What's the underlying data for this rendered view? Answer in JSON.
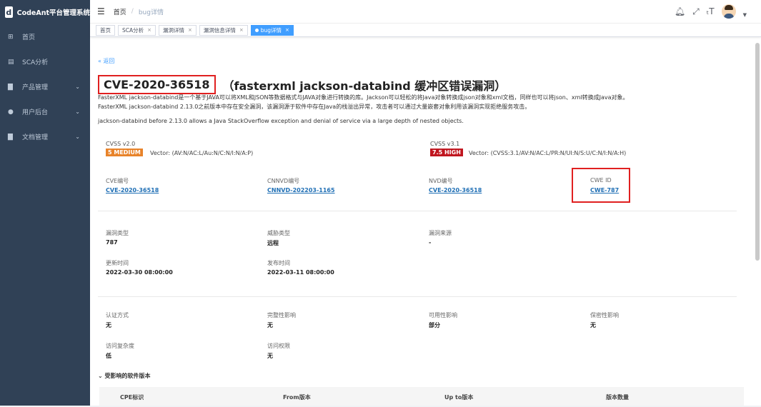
{
  "app": {
    "title": "CodeAnt平台管理系统",
    "logo_char": "d"
  },
  "sidebar": {
    "items": [
      {
        "label": "首页",
        "icon": "dashboard-icon"
      },
      {
        "label": "SCA分析",
        "icon": "table-icon"
      },
      {
        "label": "产品管理",
        "icon": "document-icon",
        "has_submenu": true
      },
      {
        "label": "用户后台",
        "icon": "user-icon",
        "has_submenu": true
      },
      {
        "label": "文档管理",
        "icon": "document-icon",
        "has_submenu": true
      }
    ]
  },
  "breadcrumb": {
    "home": "首页",
    "separator": "/",
    "current": "bug详情"
  },
  "tags": [
    {
      "label": "首页",
      "closable": false
    },
    {
      "label": "SCA分析",
      "closable": true
    },
    {
      "label": "漏洞详情",
      "closable": true
    },
    {
      "label": "漏洞信息详情",
      "closable": true
    },
    {
      "label": "bug详情",
      "closable": true,
      "active": true
    }
  ],
  "page": {
    "back_label": "« 返回",
    "cve_id": "CVE-2020-36518",
    "title_rest": "（fasterxml jackson-databind 缓冲区错误漏洞）",
    "desc_line1": "FasterXML jackson-databind是一个基于JAVA可以将XML和JSON等数据格式与JAVA对象进行转换的库。Jackson可以轻松的将Java对象转换成json对象和xml文档，同样也可以将json、xml转换成Java对象。",
    "desc_line2": "FasterXML jackson-databind 2.13.0之前版本中存在安全漏洞，该漏洞源于软件中存在Java的栈溢出异常，攻击者可以通过大量嵌套对象利用该漏洞实现拒绝服务攻击。",
    "desc_en": "jackson-databind before 2.13.0 allows a Java StackOverflow exception and denial of service via a large depth of nested objects."
  },
  "cvss": {
    "v2": {
      "label": "CVSS v2.0",
      "badge": "5 MEDIUM",
      "badge_color": "#e8832a",
      "vector": "Vector: (AV:N/AC:L/Au:N/C:N/I:N/A:P)"
    },
    "v3": {
      "label": "CVSS v3.1",
      "badge": "7.5 HIGH",
      "badge_color": "#c0161f",
      "vector": "Vector: (CVSS:3.1/AV:N/AC:L/PR:N/UI:N/S:U/C:N/I:N/A:H)"
    }
  },
  "ids": {
    "cve": {
      "label": "CVE编号",
      "value": "CVE-2020-36518"
    },
    "cnnvd": {
      "label": "CNNVD编号",
      "value": "CNNVD-202203-1165"
    },
    "nvd": {
      "label": "NVD编号",
      "value": "CVE-2020-36518"
    },
    "cwe": {
      "label": "CWE ID",
      "value": "CWE-787"
    }
  },
  "info": {
    "vuln_type": {
      "label": "漏洞类型",
      "value": "787"
    },
    "threat_type": {
      "label": "威胁类型",
      "value": "远程"
    },
    "vuln_source": {
      "label": "漏洞来源",
      "value": "-"
    },
    "updated": {
      "label": "更新时间",
      "value": "2022-03-30 08:00:00"
    },
    "published": {
      "label": "发布时间",
      "value": "2022-03-11 08:00:00"
    }
  },
  "impact": {
    "auth": {
      "label": "认证方式",
      "value": "无"
    },
    "integrity": {
      "label": "完整性影响",
      "value": "无"
    },
    "availability": {
      "label": "可用性影响",
      "value": "部分"
    },
    "confidentiality": {
      "label": "保密性影响",
      "value": "无"
    },
    "complexity": {
      "label": "访问复杂度",
      "value": "低"
    },
    "access": {
      "label": "访问权限",
      "value": "无"
    }
  },
  "affected": {
    "title": "受影响的软件版本",
    "columns": [
      "CPE标识",
      "From版本",
      "Up to版本",
      "版本数量"
    ]
  },
  "colors": {
    "sidebar_bg": "#304156",
    "accent": "#409eff",
    "highlight_box": "#e02020"
  }
}
